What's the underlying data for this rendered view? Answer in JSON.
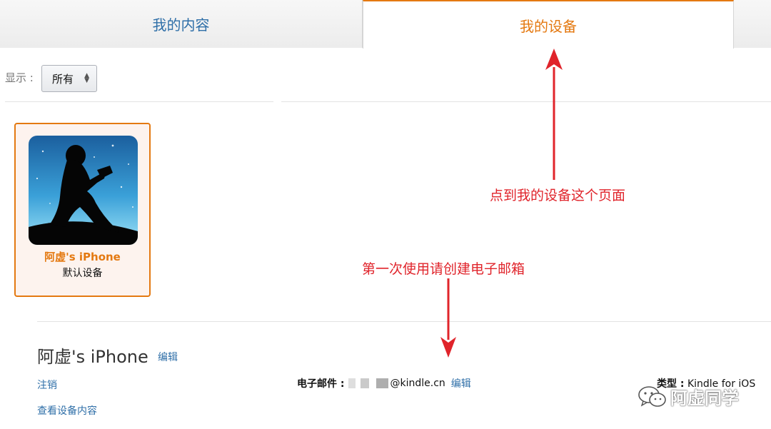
{
  "tabs": {
    "content_label": "我的内容",
    "devices_label": "我的设备"
  },
  "filter": {
    "label": "显示 :",
    "selected": "所有"
  },
  "device_card": {
    "name": "阿虚's iPhone",
    "status": "默认设备"
  },
  "detail": {
    "title": "阿虚's iPhone",
    "edit_label": "编辑",
    "deregister_label": "注销",
    "view_content_label": "查看设备内容",
    "email_label": "电子邮件 :",
    "email_suffix": "@kindle.cn",
    "email_edit_label": "编辑",
    "type_label": "类型 :",
    "type_value": "Kindle for iOS"
  },
  "annotations": {
    "tab_hint": "点到我的设备这个页面",
    "email_hint": "第一次使用请创建电子邮箱",
    "color": "#e0242b"
  },
  "watermark": {
    "text": "阿虚同学",
    "icon": "wechat-icon"
  },
  "colors": {
    "accent": "#e47911",
    "link": "#2f6fa8"
  }
}
